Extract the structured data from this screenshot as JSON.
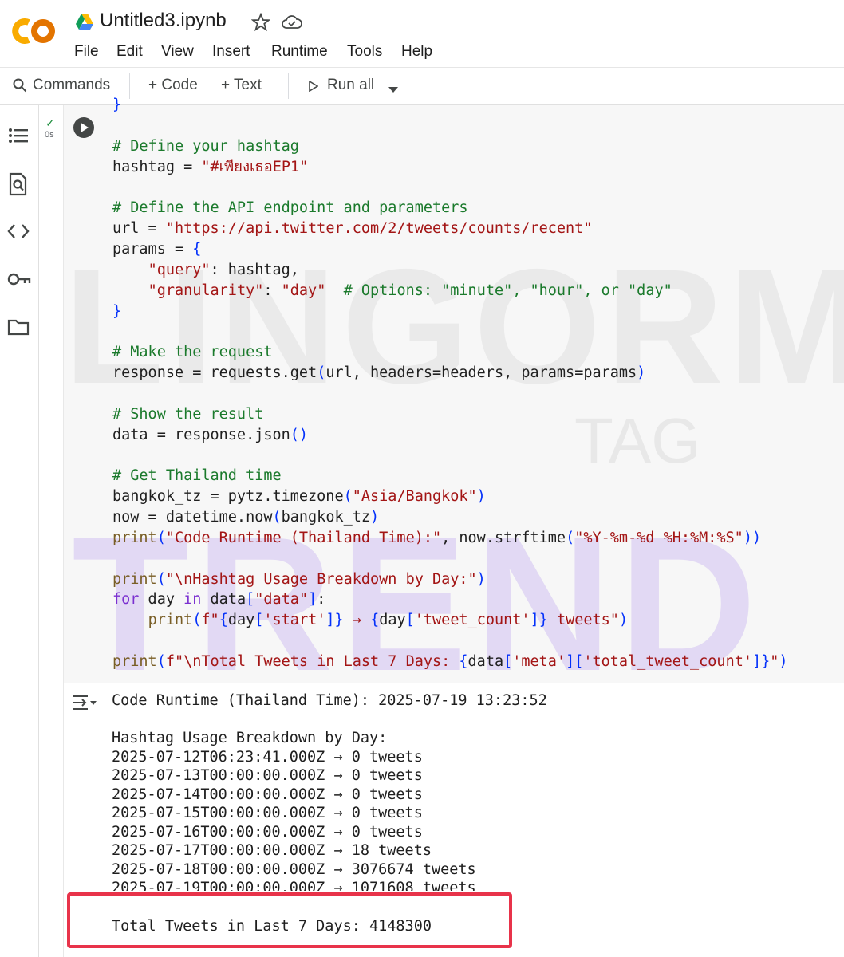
{
  "header": {
    "logo_text": "CO",
    "title": "Untitled3.ipynb",
    "menu": [
      "File",
      "Edit",
      "View",
      "Insert",
      "Runtime",
      "Tools",
      "Help"
    ]
  },
  "toolbar": {
    "commands": "Commands",
    "code": "+ Code",
    "text": "+ Text",
    "run_all": "Run all"
  },
  "sidebar": {
    "icons": [
      "table-of-contents-icon",
      "find-replace-icon",
      "code-snippets-icon",
      "secrets-key-icon",
      "files-folder-icon"
    ]
  },
  "cell": {
    "exec_time": "0s",
    "code_lines": [
      {
        "html": "<span class='br'>}</span>"
      },
      {
        "html": ""
      },
      {
        "html": "<span class='cm'># Define your hashtag</span>"
      },
      {
        "html": "hashtag = <span class='st'>\"#เพียงเธอEP1\"</span>"
      },
      {
        "html": ""
      },
      {
        "html": "<span class='cm'># Define the API endpoint and parameters</span>"
      },
      {
        "html": "url = <span class='st'>\"<span class='lk'>https://api.twitter.com/2/tweets/counts/recent</span>\"</span>"
      },
      {
        "html": "params = <span class='br'>{</span>"
      },
      {
        "html": "    <span class='st'>\"query\"</span>: hashtag,"
      },
      {
        "html": "    <span class='st'>\"granularity\"</span>: <span class='st'>\"day\"</span>  <span class='cm'># Options: \"minute\", \"hour\", or \"day\"</span>"
      },
      {
        "html": "<span class='br'>}</span>"
      },
      {
        "html": ""
      },
      {
        "html": "<span class='cm'># Make the request</span>"
      },
      {
        "html": "response = requests.get<span class='br'>(</span>url, headers=headers, params=params<span class='br'>)</span>"
      },
      {
        "html": ""
      },
      {
        "html": "<span class='cm'># Show the result</span>"
      },
      {
        "html": "data = response.json<span class='br'>()</span>"
      },
      {
        "html": ""
      },
      {
        "html": "<span class='cm'># Get Thailand time</span>"
      },
      {
        "html": "bangkok_tz = pytz.timezone<span class='br'>(</span><span class='st'>\"Asia/Bangkok\"</span><span class='br'>)</span>"
      },
      {
        "html": "now = datetime.now<span class='br'>(</span>bangkok_tz<span class='br'>)</span>"
      },
      {
        "html": "<span class='bi'>print</span><span class='br'>(</span><span class='st'>\"Code Runtime (Thailand Time):\"</span>, now.strftime<span class='br'>(</span><span class='st'>\"%Y-%m-%d %H:%M:%S\"</span><span class='br'>))</span>"
      },
      {
        "html": ""
      },
      {
        "html": "<span class='bi'>print</span><span class='br'>(</span><span class='st'>\"\\nHashtag Usage Breakdown by Day:\"</span><span class='br'>)</span>"
      },
      {
        "html": "<span class='kw'>for</span> day <span class='kw'>in</span> data<span class='br'>[</span><span class='st'>\"data\"</span><span class='br'>]</span>:"
      },
      {
        "html": "    <span class='bi'>print</span><span class='br'>(</span><span class='st'>f\"</span><span class='br'>{</span>day<span class='br'>[</span><span class='st'>'start'</span><span class='br'>]}</span><span class='st'> → </span><span class='br'>{</span>day<span class='br'>[</span><span class='st'>'tweet_count'</span><span class='br'>]}</span><span class='st'> tweets\"</span><span class='br'>)</span>"
      },
      {
        "html": ""
      },
      {
        "html": "<span class='bi'>print</span><span class='br'>(</span><span class='st'>f\"\\nTotal Tweets in Last 7 Days: </span><span class='br'>{</span>data<span class='br'>[</span><span class='st'>'meta'</span><span class='br'>][</span><span class='st'>'total_tweet_count'</span><span class='br'>]}</span><span class='st'>\"</span><span class='br'>)</span>"
      }
    ]
  },
  "output": {
    "runtime_line": "Code Runtime (Thailand Time): 2025-07-19 13:23:52",
    "breakdown_title": "Hashtag Usage Breakdown by Day:",
    "rows": [
      "2025-07-12T06:23:41.000Z → 0 tweets",
      "2025-07-13T00:00:00.000Z → 0 tweets",
      "2025-07-14T00:00:00.000Z → 0 tweets",
      "2025-07-15T00:00:00.000Z → 0 tweets",
      "2025-07-16T00:00:00.000Z → 0 tweets",
      "2025-07-17T00:00:00.000Z → 18 tweets",
      "2025-07-18T00:00:00.000Z → 3076674 tweets",
      "2025-07-19T00:00:00.000Z → 1071608 tweets"
    ],
    "total_line": "Total Tweets in Last 7 Days: 4148300"
  },
  "watermark": {
    "line1": "LINGORM",
    "line2": "TAG",
    "line3": "TREND"
  },
  "colors": {
    "logo_orange": "#f9ab00",
    "logo_dark_orange": "#e37400",
    "highlight": "#e8334a",
    "comment": "#1b7a2c",
    "string": "#a31515"
  }
}
